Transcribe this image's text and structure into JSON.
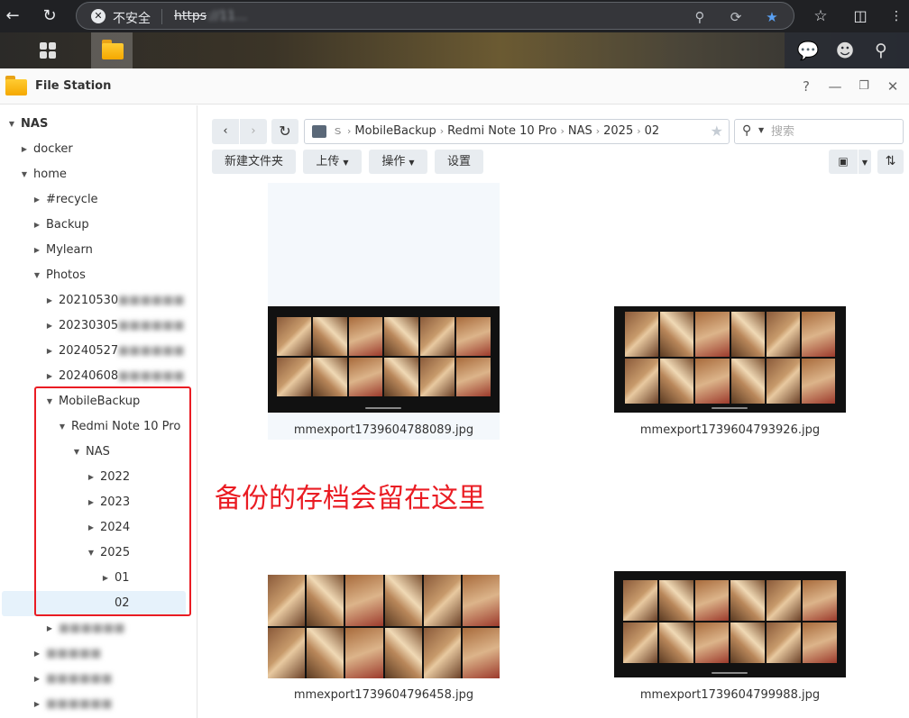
{
  "browser": {
    "insecure_label": "不安全",
    "url_scheme": "https",
    "url_rest": "://11..."
  },
  "window": {
    "title": "File Station"
  },
  "sidebar": {
    "root": "NAS",
    "items": [
      {
        "label": "docker"
      },
      {
        "label": "home"
      },
      {
        "label": "#recycle"
      },
      {
        "label": "Backup"
      },
      {
        "label": "Mylearn"
      },
      {
        "label": "Photos"
      },
      {
        "label": "20210530"
      },
      {
        "label": "20230305"
      },
      {
        "label": "20240527"
      },
      {
        "label": "20240608"
      },
      {
        "label": "MobileBackup"
      },
      {
        "label": "Redmi Note 10 Pro"
      },
      {
        "label": "NAS"
      },
      {
        "label": "2022"
      },
      {
        "label": "2023"
      },
      {
        "label": "2024"
      },
      {
        "label": "2025"
      },
      {
        "label": "01"
      },
      {
        "label": "02"
      }
    ]
  },
  "toolbar": {
    "path": [
      "MobileBackup",
      "Redmi Note 10 Pro",
      "NAS",
      "2025",
      "02"
    ],
    "new_folder": "新建文件夹",
    "upload": "上传",
    "action": "操作",
    "settings": "设置",
    "search_placeholder": "搜索"
  },
  "files": [
    {
      "name": "mmexport1739604788089.jpg"
    },
    {
      "name": "mmexport1739604793926.jpg"
    },
    {
      "name": "mmexport1739604796458.jpg"
    },
    {
      "name": "mmexport1739604799988.jpg"
    }
  ],
  "annotation": {
    "text": "备份的存档会留在这里",
    "color": "#ea1c23"
  }
}
